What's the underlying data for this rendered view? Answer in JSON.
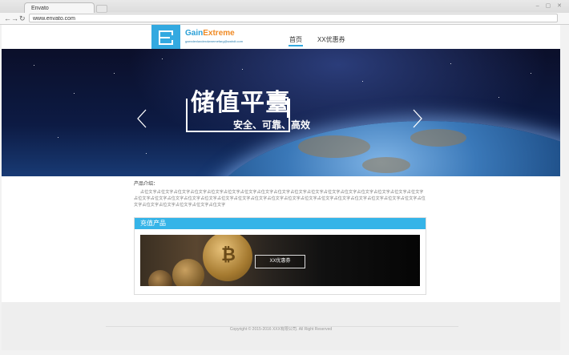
{
  "browser": {
    "tab_title": "Envato",
    "url": "www.envato.com",
    "back_icon": "back-arrow-icon",
    "forward_icon": "forward-arrow-icon",
    "refresh_icon": "refresh-icon"
  },
  "header": {
    "logo_text_1": "Gain",
    "logo_text_2": "Extreme",
    "logo_sub": "gaexdexlaxdexdwnemefarg@wahdt.com",
    "nav": [
      {
        "label": "首页",
        "active": true
      },
      {
        "label": "XX优惠券",
        "active": false
      }
    ]
  },
  "banner": {
    "title": "储值平臺",
    "subtitle": "安全、可靠、高效",
    "prev_icon": "chevron-left-icon",
    "next_icon": "chevron-right-icon"
  },
  "content": {
    "intro_label": "产品介绍：",
    "intro_text": "占位文字占位文字占位文字占位文字占位文字占位文字占位文字占位文字占位文字占位文字占位文字占位文字占位文字占位文字占位文字占位文字占位文字占位文字占位文字占位文字占位文字占位文字占位文字占位文字占位文字占位文字占位文字占位文字占位文字占位文字占位文字占位文字占位文字占位文字占位文字占位文字占位文字占位文字占位文字占位文字",
    "product_header": "充值产品",
    "product_button": "XX优惠券"
  },
  "footer": {
    "copyright": "Copyright © 2015-2016 XXX有限公司. All Right Reserved"
  },
  "colors": {
    "accent": "#35b4e8",
    "logo_orange": "#f08a24"
  }
}
